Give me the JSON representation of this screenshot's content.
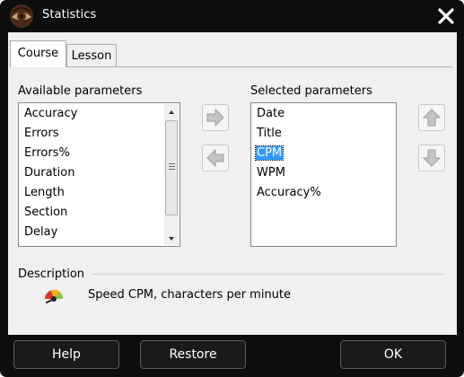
{
  "window": {
    "title": "Statistics"
  },
  "icons": {
    "app": "eye-logo-icon",
    "close": "close-icon",
    "description": "speed-gauge-icon"
  },
  "tabs": [
    {
      "label": "Course",
      "active": true
    },
    {
      "label": "Lesson",
      "active": false
    }
  ],
  "available": {
    "label": "Available parameters",
    "items": [
      "Accuracy",
      "Errors",
      "Errors%",
      "Duration",
      "Length",
      "Section",
      "Delay"
    ]
  },
  "selected": {
    "label": "Selected parameters",
    "items": [
      "Date",
      "Title",
      "CPM",
      "WPM",
      "Accuracy%"
    ],
    "selected_item": "CPM"
  },
  "description": {
    "label": "Description",
    "text": "Speed CPM, characters per minute"
  },
  "buttons": {
    "help": "Help",
    "restore": "Restore",
    "ok": "OK"
  }
}
